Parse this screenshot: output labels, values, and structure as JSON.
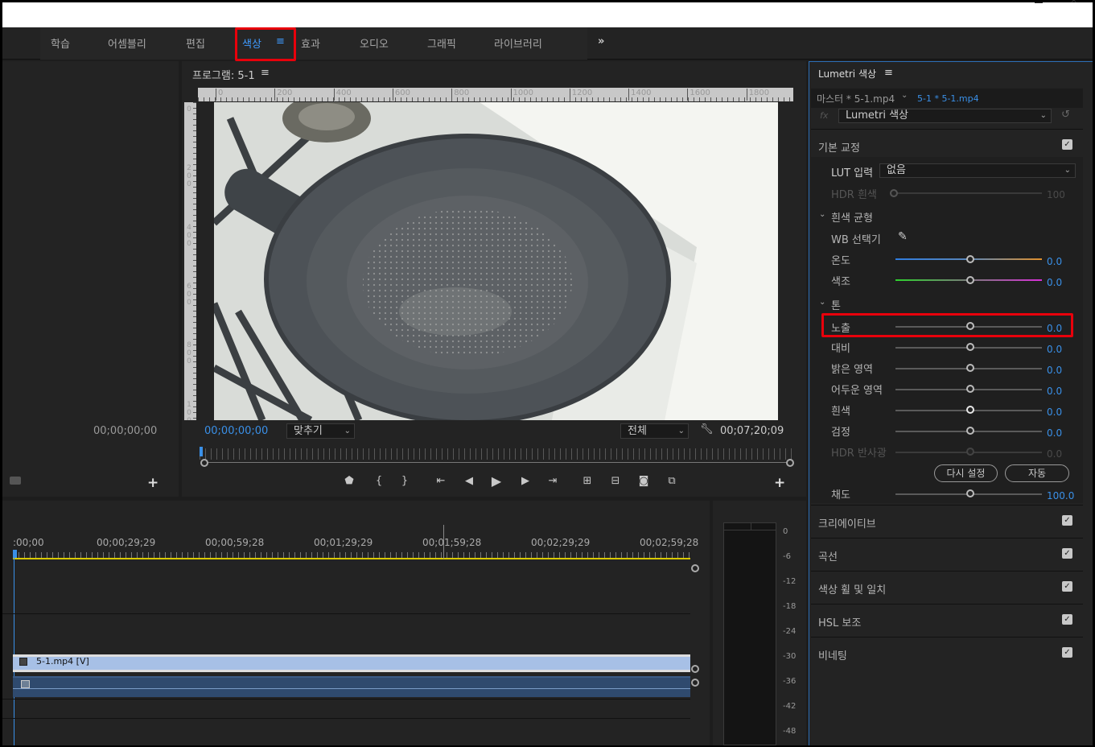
{
  "workspaces": {
    "tabs": [
      "학습",
      "어셈블리",
      "편집",
      "색상",
      "효과",
      "오디오",
      "그래픽",
      "라이브러리"
    ],
    "active": "색상",
    "active_menu_icon": "≡",
    "overflow": "»"
  },
  "source_panel": {
    "timecode": "00;00;00;00"
  },
  "program_monitor": {
    "title": "프로그램: 5-1",
    "menu_icon": "≡",
    "ruler_labels": [
      "0",
      "200",
      "400",
      "600",
      "800",
      "1000",
      "1200",
      "1400",
      "1600",
      "1800"
    ],
    "vruler_labels": [
      "0",
      "200",
      "400",
      "600",
      "800",
      "100"
    ],
    "current_timecode": "00;00;00;00",
    "fit_label": "맞추기",
    "resolution_label": "전체",
    "duration_timecode": "00;07;20;09"
  },
  "lumetri": {
    "title": "Lumetri 색상",
    "menu_icon": "≡",
    "master_clip": "마스터 * 5-1.mp4",
    "sequence_clip": "5-1 * 5-1.mp4",
    "fx_label": "fx",
    "effect_name": "Lumetri 색상",
    "basic_correction": "기본 교정",
    "lut_label": "LUT 입력",
    "lut_value": "없음",
    "hdr_white_label": "HDR 흰색",
    "hdr_white_value": "100",
    "white_balance": "흰색 균형",
    "wb_picker": "WB 선택기",
    "temperature_label": "온도",
    "temperature_value": "0.0",
    "tint_label": "색조",
    "tint_value": "0.0",
    "tone": "톤",
    "exposure_label": "노출",
    "exposure_value": "0.0",
    "contrast_label": "대비",
    "contrast_value": "0.0",
    "highlights_label": "밝은 영역",
    "highlights_value": "0.0",
    "shadows_label": "어두운 영역",
    "shadows_value": "0.0",
    "whites_label": "흰색",
    "whites_value": "0.0",
    "blacks_label": "검정",
    "blacks_value": "0.0",
    "hdr_specular_label": "HDR 반사광",
    "hdr_specular_value": "0.0",
    "reset_button": "다시 설정",
    "auto_button": "자동",
    "saturation_label": "채도",
    "saturation_value": "100.0",
    "sections": [
      "크리에이티브",
      "곡선",
      "색상 휠 및 일치",
      "HSL 보조",
      "비네팅"
    ]
  },
  "timeline": {
    "ruler_labels": [
      ":00;00",
      "00;00;29;29",
      "00;00;59;28",
      "00;01;29;29",
      "00;01;59;28",
      "00;02;29;29",
      "00;02;59;28"
    ],
    "video_clip": "5-1.mp4 [V]"
  },
  "audio_meter": {
    "labels": [
      "0",
      "-6",
      "-12",
      "-18",
      "-24",
      "-30",
      "-36",
      "-42",
      "-48"
    ]
  }
}
